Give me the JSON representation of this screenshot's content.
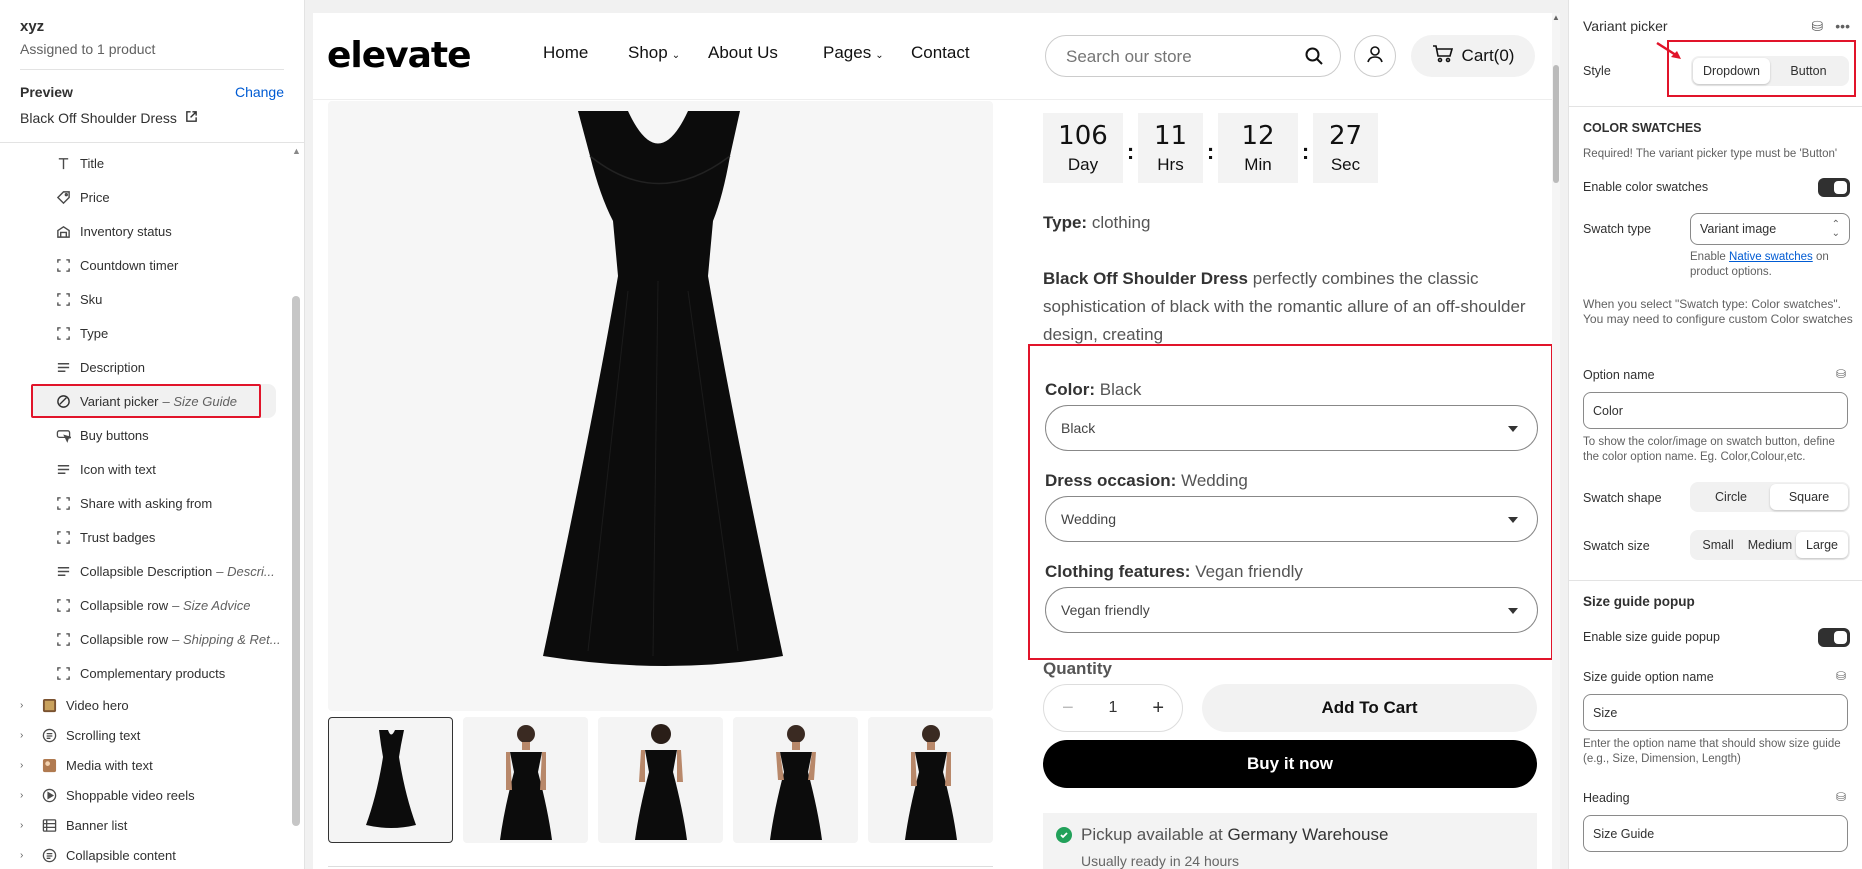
{
  "left": {
    "template_name": "xyz",
    "assigned": "Assigned to 1 product",
    "preview_label": "Preview",
    "change_label": "Change",
    "preview_product": "Black Off Shoulder Dress",
    "blocks": [
      {
        "label": "Title",
        "icon": "title-icon"
      },
      {
        "label": "Price",
        "icon": "price-tag-icon"
      },
      {
        "label": "Inventory status",
        "icon": "inventory-icon"
      },
      {
        "label": "Countdown timer",
        "icon": "block-icon"
      },
      {
        "label": "Sku",
        "icon": "block-icon"
      },
      {
        "label": "Type",
        "icon": "block-icon"
      },
      {
        "label": "Description",
        "icon": "text-lines-icon"
      },
      {
        "label": "Variant picker",
        "sub": "– Size Guide",
        "icon": "variant-icon",
        "selected": true
      },
      {
        "label": "Buy buttons",
        "icon": "buy-button-icon"
      },
      {
        "label": "Icon with text",
        "icon": "text-lines-icon"
      },
      {
        "label": "Share with asking from",
        "icon": "block-icon"
      },
      {
        "label": "Trust badges",
        "icon": "block-icon"
      },
      {
        "label": "Collapsible Description",
        "sub": "– Descri...",
        "icon": "text-lines-icon"
      },
      {
        "label": "Collapsible row",
        "sub": "– Size Advice",
        "icon": "block-icon"
      },
      {
        "label": "Collapsible row",
        "sub": "– Shipping & Ret...",
        "icon": "block-icon"
      },
      {
        "label": "Complementary products",
        "icon": "block-icon"
      }
    ],
    "sections": [
      {
        "label": "Video hero",
        "icon": "video-thumb-icon"
      },
      {
        "label": "Scrolling text",
        "icon": "scroll-text-icon"
      },
      {
        "label": "Media with text",
        "icon": "media-thumb-icon"
      },
      {
        "label": "Shoppable video reels",
        "icon": "play-icon"
      },
      {
        "label": "Banner list",
        "icon": "banner-icon"
      },
      {
        "label": "Collapsible content",
        "icon": "scroll-text-icon"
      }
    ]
  },
  "store": {
    "logo": "elevate",
    "nav": [
      "Home",
      "Shop",
      "About Us",
      "Pages",
      "Contact"
    ],
    "search_placeholder": "Search our store",
    "cart_label": "Cart(0)",
    "countdown": [
      {
        "value": "106",
        "unit": "Day"
      },
      {
        "value": "11",
        "unit": "Hrs"
      },
      {
        "value": "12",
        "unit": "Min"
      },
      {
        "value": "27",
        "unit": "Sec"
      }
    ],
    "type_label": "Type:",
    "type_value": "clothing",
    "desc_bold": "Black Off Shoulder Dress",
    "desc_rest": " perfectly combines the classic sophistication of black with the romantic allure of an off-shoulder design, creating",
    "variants": [
      {
        "label": "Color:",
        "value": "Black",
        "selected": "Black"
      },
      {
        "label": "Dress occasion:",
        "value": "Wedding",
        "selected": "Wedding"
      },
      {
        "label": "Clothing features:",
        "value": "Vegan friendly",
        "selected": "Vegan friendly"
      }
    ],
    "quantity_label": "Quantity",
    "quantity_value": "1",
    "add_to_cart": "Add To Cart",
    "buy_now": "Buy it now",
    "pickup_prefix": "Pickup available at ",
    "pickup_location": "Germany Warehouse",
    "pickup_note": "Usually ready in 24 hours"
  },
  "settings": {
    "title": "Variant picker",
    "style_label": "Style",
    "style_options": [
      "Dropdown",
      "Button"
    ],
    "style_selected": "Dropdown",
    "color_swatches_header": "COLOR SWATCHES",
    "color_swatches_help": "Required! The variant picker type must be 'Button'",
    "enable_color_swatches": "Enable color swatches",
    "swatch_type_label": "Swatch type",
    "swatch_type_value": "Variant image",
    "native_help_pre": "Enable ",
    "native_help_link": "Native swatches",
    "native_help_post": " on product options.",
    "select_help": "When you select \"Swatch type: Color swatches\". You may need to configure custom Color swatches",
    "option_name_label": "Option name",
    "option_name_value": "Color",
    "option_name_help": "To show the color/image on swatch button, define the color option name. Eg. Color,Colour,etc.",
    "swatch_shape_label": "Swatch shape",
    "swatch_shape_options": [
      "Circle",
      "Square"
    ],
    "swatch_size_label": "Swatch size",
    "swatch_size_options": [
      "Small",
      "Medium",
      "Large"
    ],
    "size_guide_header": "Size guide popup",
    "enable_size_guide": "Enable size guide popup",
    "size_guide_option_label": "Size guide option name",
    "size_guide_option_value": "Size",
    "size_guide_help": "Enter the option name that should show size guide (e.g., Size, Dimension, Length)",
    "heading_label": "Heading",
    "heading_value": "Size Guide"
  },
  "colors": {
    "highlight": "#e1142a",
    "link": "#005bd3",
    "buy_now_bg": "#000000",
    "pickup_check": "#22a15a"
  }
}
